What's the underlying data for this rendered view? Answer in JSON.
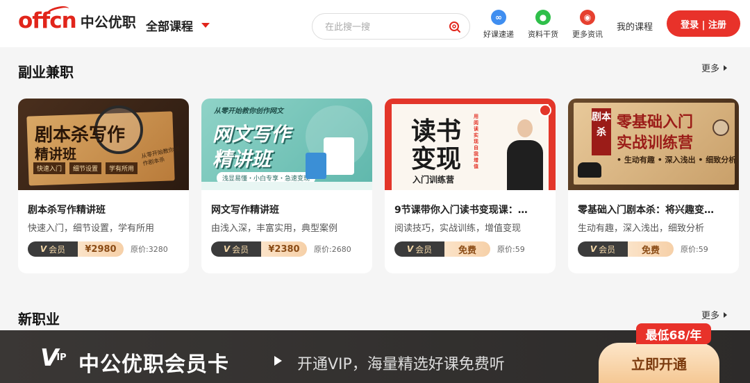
{
  "header": {
    "logo_mark": "offcn",
    "logo_cn": "中公优职",
    "all_courses": "全部课程",
    "search_placeholder": "在此搜一搜",
    "quick_links": [
      {
        "label": "好课速递",
        "icon": "link-icon",
        "color": "#3f8ef0",
        "glyph": "∞"
      },
      {
        "label": "资料干货",
        "icon": "wechat-icon",
        "color": "#2fbf4a",
        "glyph": "●"
      },
      {
        "label": "更多资讯",
        "icon": "weibo-icon",
        "color": "#e6402f",
        "glyph": "◉"
      }
    ],
    "my_courses": "我的课程",
    "login": "登录 | 注册"
  },
  "section1": {
    "title": "副业兼职",
    "more": "更多"
  },
  "section2": {
    "title": "新职业",
    "more": "更多"
  },
  "cards": [
    {
      "title": "剧本杀写作精讲班",
      "desc": "快速入门，细节设置，学有所用",
      "vip": "会员",
      "price": "¥2980",
      "orig": "原价:3280",
      "thumb": {
        "main1": "剧本杀写作",
        "main2": "精讲班",
        "tags": [
          "快速入门",
          "细节设置",
          "学有所用"
        ],
        "note": "从零开始教你创作剧本杀"
      }
    },
    {
      "title": "网文写作精讲班",
      "desc": "由浅入深，丰富实用，典型案例",
      "vip": "会员",
      "price": "¥2380",
      "orig": "原价:2680",
      "thumb": {
        "top": "从零开始教你创作网文",
        "main1": "网文写作",
        "main2": "精讲班",
        "sub": "浅显易懂・小白专享・急速变现"
      }
    },
    {
      "title": "9节课带你入门读书变现课：…",
      "desc": "阅读技巧，实战训练，增值变现",
      "vip": "会员",
      "price": "免费",
      "orig": "原价:59",
      "thumb": {
        "main1": "读书",
        "main2": "变现",
        "sub": "入门训练营",
        "side": "用阅读实现自我增值"
      }
    },
    {
      "title": "零基础入门剧本杀：将兴趣变…",
      "desc": "生动有趣，深入浅出，细致分析",
      "vip": "会员",
      "price": "免费",
      "orig": "原价:59",
      "thumb": {
        "seal": "剧本杀",
        "main1": "零基础入门",
        "main2": "实战训练营",
        "sub": "• 生动有趣 • 深入浅出 • 细致分析"
      }
    }
  ],
  "banner": {
    "vip": "V",
    "vip_small": "IP",
    "title": "中公优职会员卡",
    "sub": "开通VIP，海量精选好课免费听",
    "badge": "最低68/年",
    "button": "立即开通"
  }
}
